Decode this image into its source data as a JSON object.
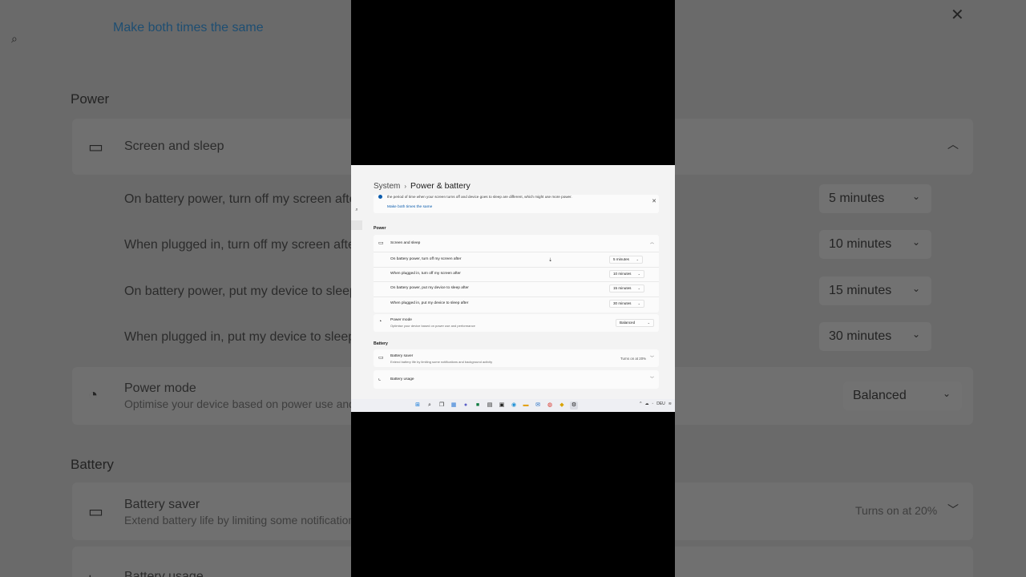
{
  "background": {
    "link": "Make both times the same",
    "power_heading": "Power",
    "screen_sleep": "Screen and sleep",
    "rows": [
      {
        "label": "On battery power, turn off my screen afte",
        "value": "5 minutes"
      },
      {
        "label": "When plugged in, turn off my screen afte",
        "value": "10 minutes"
      },
      {
        "label": "On battery power, put my device to sleep",
        "value": "15 minutes"
      },
      {
        "label": "When plugged in, put my device to sleep",
        "value": "30 minutes"
      }
    ],
    "power_mode": "Power mode",
    "power_mode_sub": "Optimise your device based on power use and",
    "power_mode_value": "Balanced",
    "battery_heading": "Battery",
    "battery_saver": "Battery saver",
    "battery_saver_sub": "Extend battery life by limiting some notification",
    "battery_saver_status": "Turns on at 20%",
    "battery_usage": "Battery usage"
  },
  "breadcrumb": {
    "root": "System",
    "current": "Power & battery"
  },
  "info": {
    "text": "the period of time when your screen turns off and device goes to sleep are different, which might use more power.",
    "link": "Make both times the same"
  },
  "power": {
    "heading": "Power",
    "screen_sleep": {
      "title": "Screen and sleep",
      "rows": [
        {
          "label": "On battery power, turn off my screen after",
          "value": "5 minutes"
        },
        {
          "label": "When plugged in, turn off my screen after",
          "value": "10 minutes"
        },
        {
          "label": "On battery power, put my device to sleep after",
          "value": "15 minutes"
        },
        {
          "label": "When plugged in, put my device to sleep after",
          "value": "30 minutes"
        }
      ]
    },
    "power_mode": {
      "title": "Power mode",
      "subtitle": "Optimise your device based on power use and performance",
      "value": "Balanced"
    }
  },
  "battery": {
    "heading": "Battery",
    "saver": {
      "title": "Battery saver",
      "subtitle": "Extend battery life by limiting some notifications and background activity",
      "status": "Turns on at 20%"
    },
    "usage": {
      "title": "Battery usage"
    }
  },
  "taskbar": {
    "tray_lang": "DEU"
  },
  "colors": {
    "accent": "#0b5cad",
    "window_bg": "#f3f3f3",
    "card_bg": "#fbfbfb",
    "backdrop": "#000000"
  }
}
